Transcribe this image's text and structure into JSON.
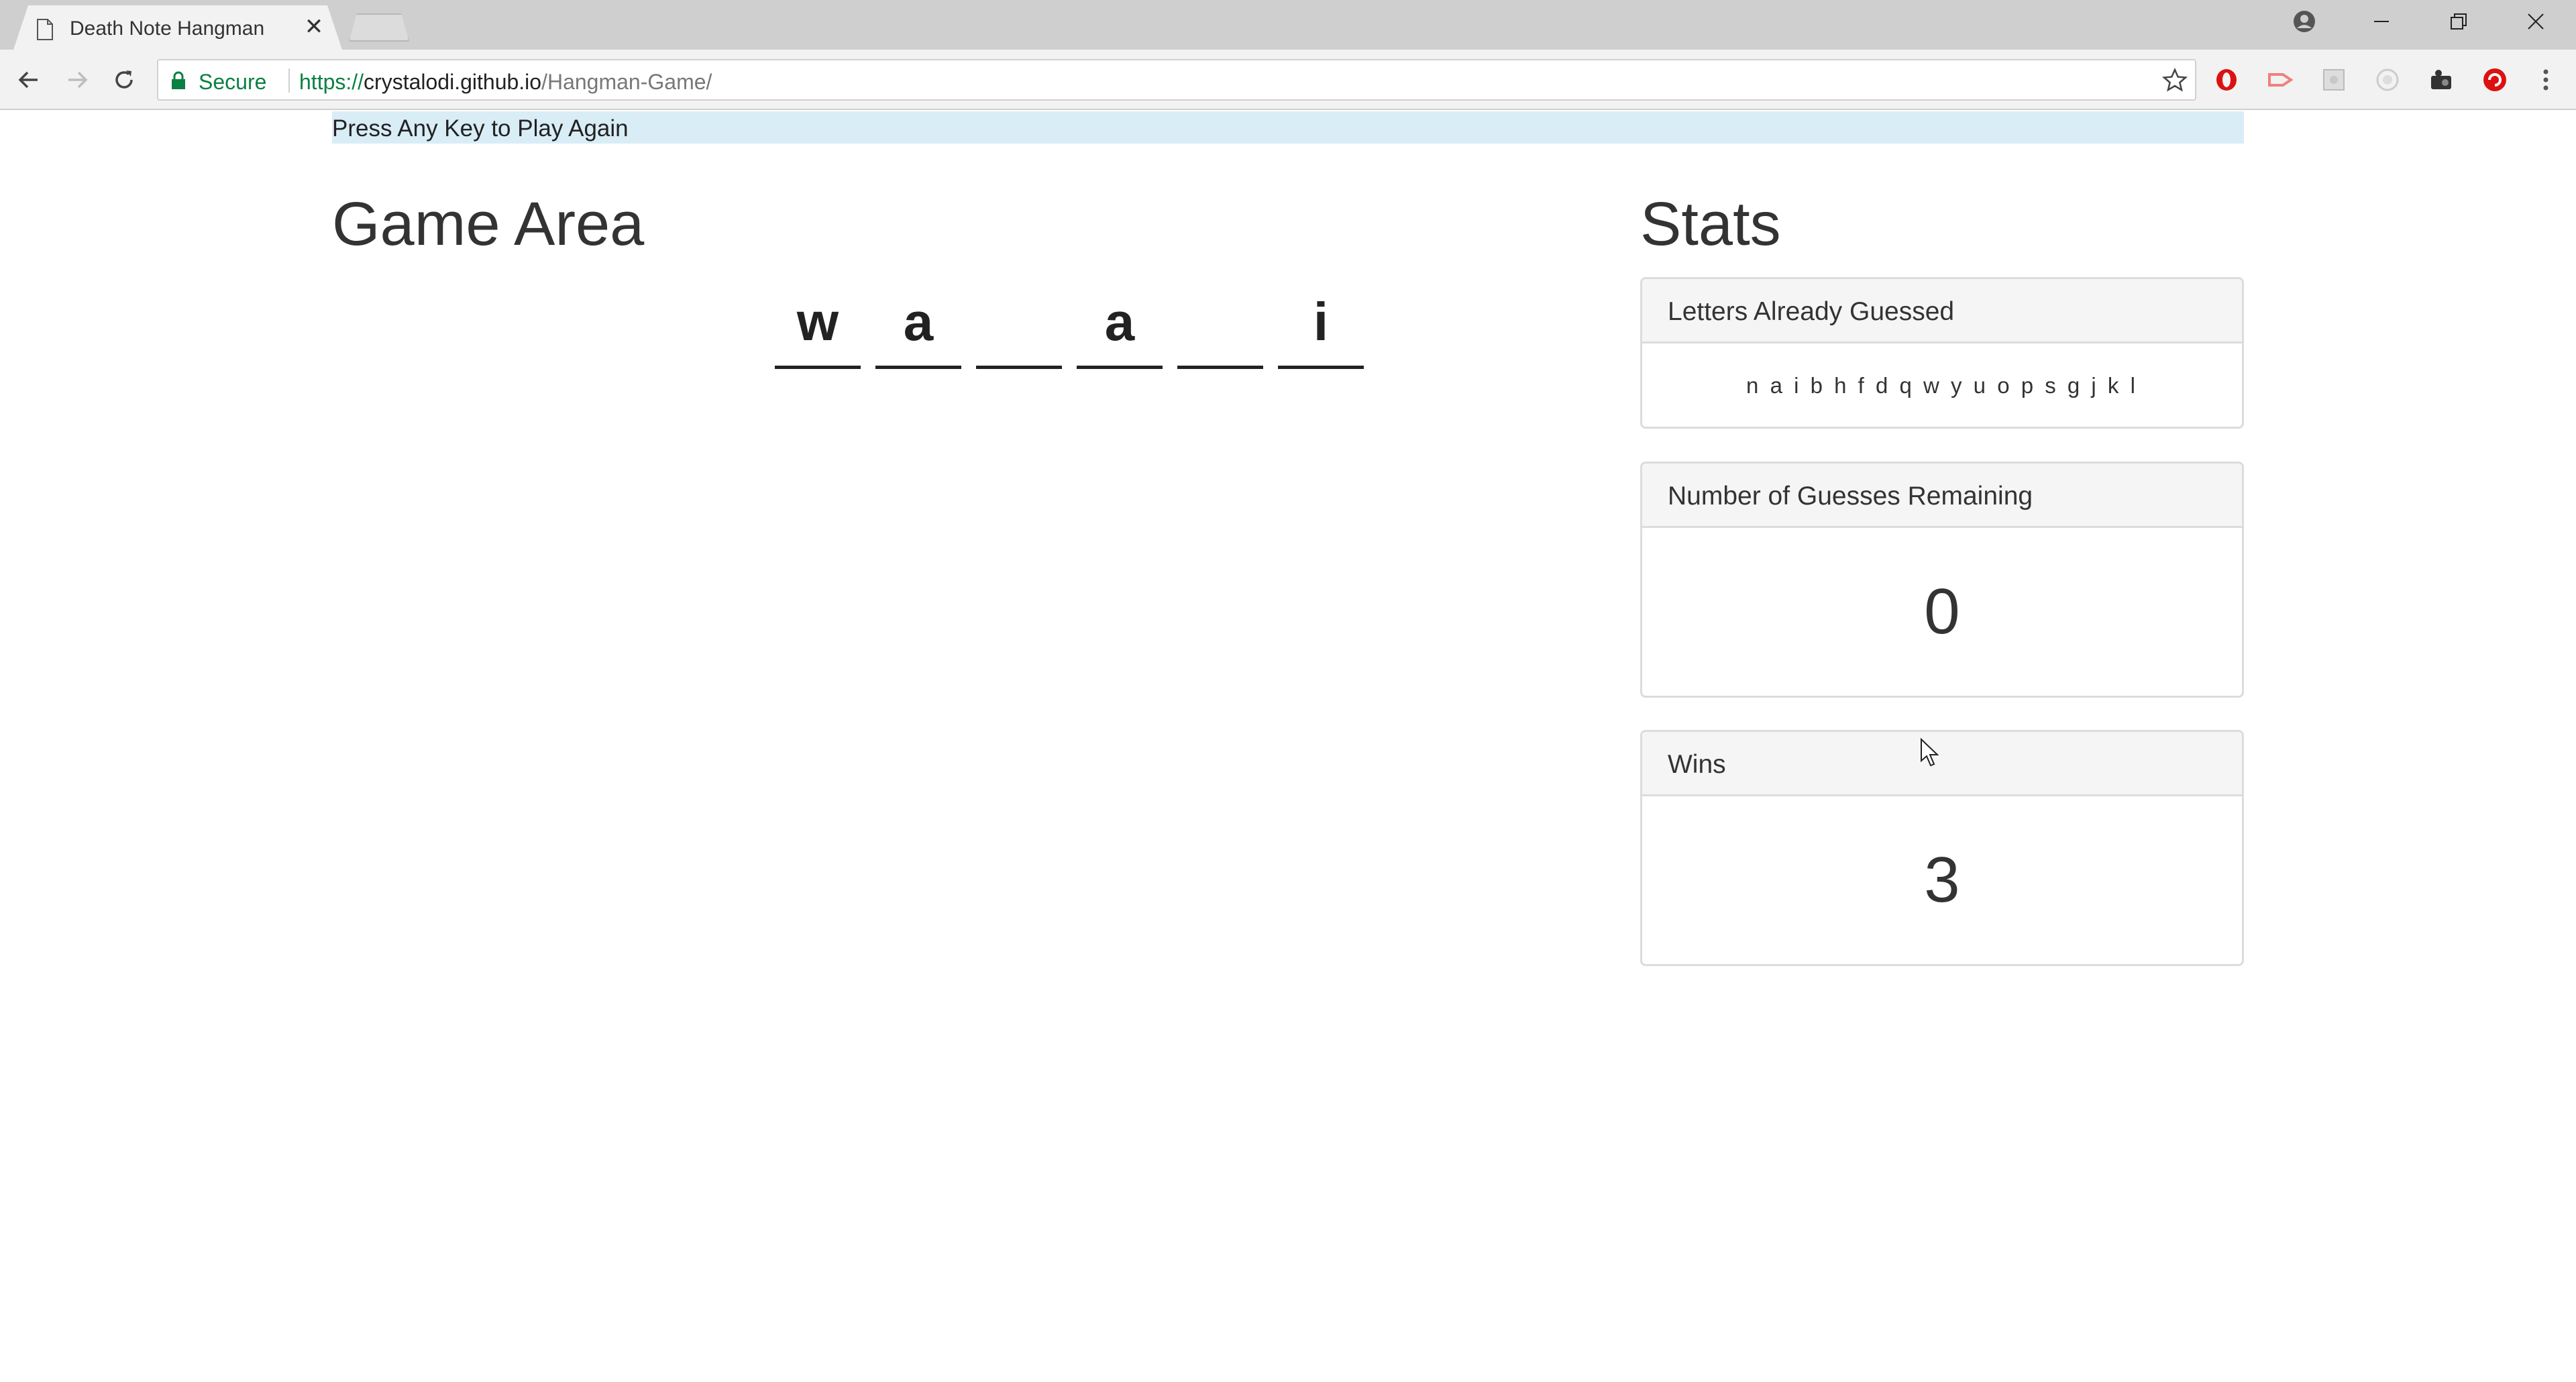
{
  "browser": {
    "tab_title": "Death Note Hangman",
    "tab_close": "✕",
    "secure_label": "Secure",
    "url_scheme": "https://",
    "url_host": "crystalodi.github.io",
    "url_path": "/Hangman-Game/",
    "extensions": [
      "opera-icon",
      "cast-icon",
      "puzzle-icon",
      "reader-icon",
      "camera-icon",
      "blocker-icon"
    ]
  },
  "page": {
    "alert_text": "Press Any Key to Play Again",
    "game_heading": "Game Area",
    "stats_heading": "Stats",
    "word_slots": [
      "w",
      "a",
      "",
      "a",
      "",
      "i"
    ]
  },
  "stats": {
    "guessed_title": "Letters Already Guessed",
    "guessed_letters": "n a i b h f d q w y u o p s g j k l",
    "remaining_title": "Number of Guesses Remaining",
    "remaining_value": "0",
    "wins_title": "Wins",
    "wins_value": "3"
  },
  "colors": {
    "alert_bg": "#d9edf7",
    "secure_green": "#0b8043",
    "panel_head_bg": "#f5f5f5"
  }
}
